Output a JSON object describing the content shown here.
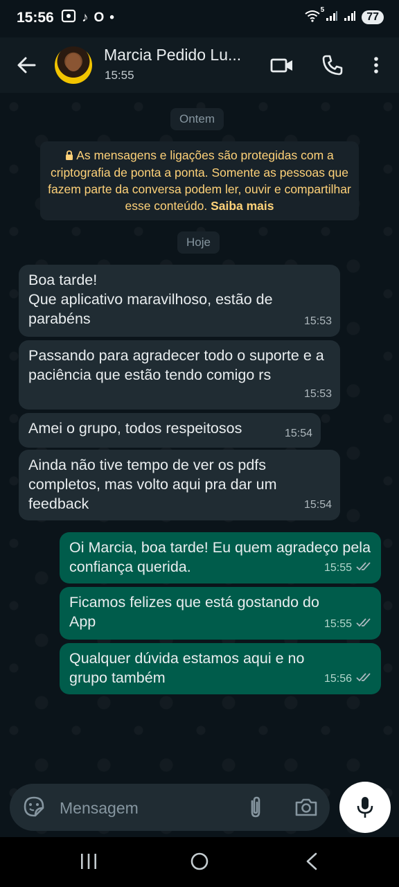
{
  "status_bar": {
    "time": "15:56",
    "battery": "77",
    "network_sup": "5",
    "tiktok_glyph": "♪",
    "o_glyph": "O",
    "dot": "•"
  },
  "header": {
    "contact_name": "Marcia Pedido Lu...",
    "subtitle": "15:55"
  },
  "chat": {
    "day_yesterday": "Ontem",
    "encryption_notice": "As mensagens e ligações são protegidas com a criptografia de ponta a ponta. Somente as pessoas que fazem parte da conversa podem ler, ouvir e compartilhar esse conteúdo.",
    "encryption_link": "Saiba mais",
    "day_today": "Hoje",
    "messages": [
      {
        "direction": "in",
        "text": "Boa tarde!\nQue aplicativo maravilhoso, estão de parabéns",
        "time": "15:53"
      },
      {
        "direction": "in",
        "text": "Passando para agradecer todo o suporte e a paciência que estão tendo comigo rs",
        "time": "15:53"
      },
      {
        "direction": "in",
        "text": "Amei o grupo, todos respeitosos",
        "time": "15:54"
      },
      {
        "direction": "in",
        "text": "Ainda não tive tempo de ver os pdfs completos, mas volto aqui pra dar um feedback",
        "time": "15:54"
      },
      {
        "direction": "out",
        "text": "Oi Marcia, boa tarde! Eu quem agradeço pela confiança querida.",
        "time": "15:55",
        "status": "read"
      },
      {
        "direction": "out",
        "text": "Ficamos felizes que está gostando do App",
        "time": "15:55",
        "status": "read"
      },
      {
        "direction": "out",
        "text": "Qualquer dúvida estamos aqui e no grupo também",
        "time": "15:56",
        "status": "read"
      }
    ]
  },
  "composer": {
    "placeholder": "Mensagem"
  },
  "icons": {
    "back": "arrow-left-icon",
    "video": "video-call-icon",
    "call": "phone-icon",
    "menu": "more-vert-icon",
    "emoji": "sticker-icon",
    "attach": "paperclip-icon",
    "camera": "camera-icon",
    "mic": "mic-icon",
    "lock": "lock-icon"
  },
  "colors": {
    "background": "#0b141a",
    "header": "#111b21",
    "incoming": "#202c33",
    "outgoing": "#005c4b",
    "notice_text": "#ffd279",
    "read_ticks": "#aebac1"
  }
}
